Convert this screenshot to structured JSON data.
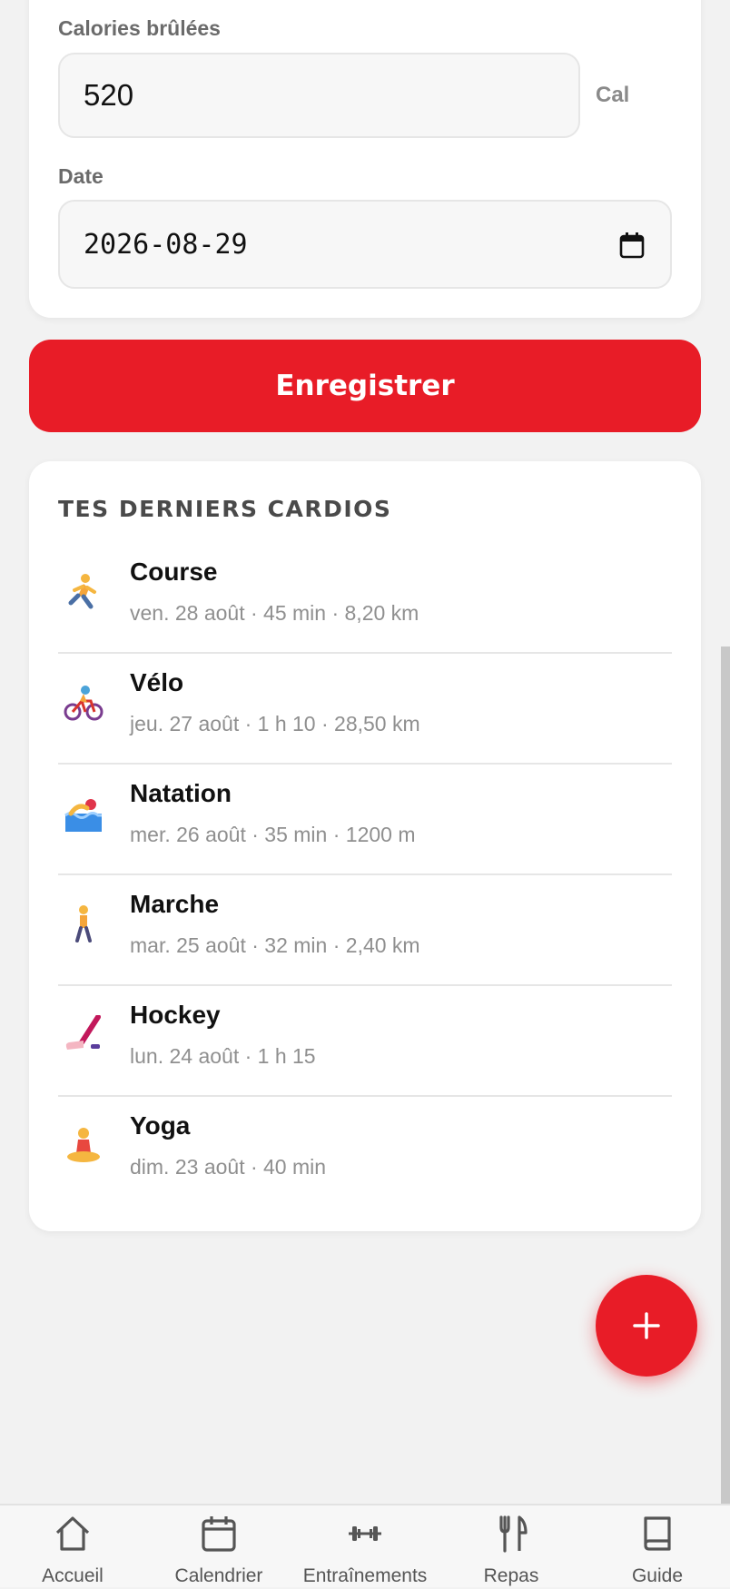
{
  "form": {
    "calories_label": "Calories brûlées",
    "calories_value": "520",
    "calories_unit": "Cal",
    "date_label": "Date",
    "date_value": "2026-08-29",
    "save_label": "Enregistrer"
  },
  "recent": {
    "title": "TES DERNIERS CARDIOS",
    "items": [
      {
        "icon": "running-person-icon",
        "title": "Course",
        "details": "ven. 28 août · 45 min · 8,20 km"
      },
      {
        "icon": "cyclist-icon",
        "title": "Vélo",
        "details": "jeu. 27 août · 1 h 10 · 28,50 km"
      },
      {
        "icon": "swimmer-icon",
        "title": "Natation",
        "details": "mer. 26 août · 35 min · 1200 m"
      },
      {
        "icon": "walking-person-icon",
        "title": "Marche",
        "details": "mar. 25 août · 32 min · 2,40 km"
      },
      {
        "icon": "hockey-stick-icon",
        "title": "Hockey",
        "details": "lun. 24 août · 1 h 15"
      },
      {
        "icon": "yoga-person-icon",
        "title": "Yoga",
        "details": "dim. 23 août · 40 min"
      }
    ]
  },
  "fab": {
    "icon": "plus-icon"
  },
  "nav": {
    "items": [
      {
        "label": "Accueil",
        "icon": "home-icon"
      },
      {
        "label": "Calendrier",
        "icon": "calendar-icon"
      },
      {
        "label": "Entraînements",
        "icon": "dumbbell-icon"
      },
      {
        "label": "Repas",
        "icon": "fork-knife-icon"
      },
      {
        "label": "Guide",
        "icon": "book-icon"
      }
    ]
  },
  "colors": {
    "accent": "#e81c27",
    "background": "#f2f2f2",
    "card": "#ffffff"
  }
}
